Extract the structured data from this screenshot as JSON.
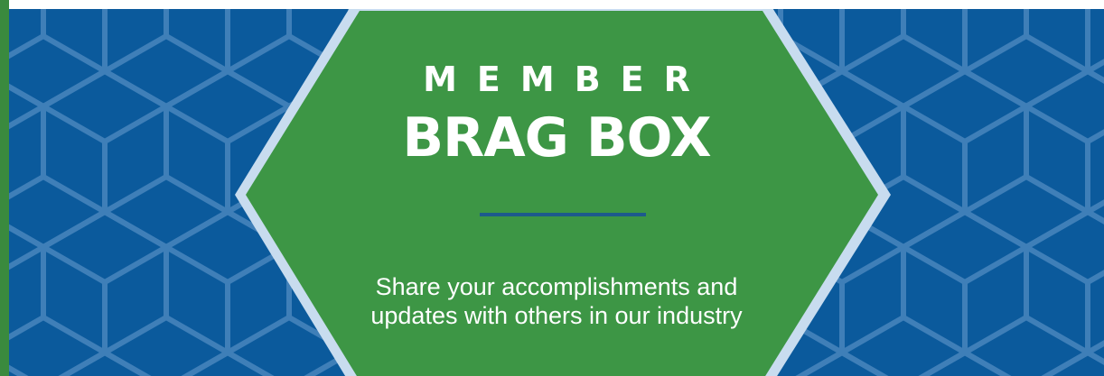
{
  "banner": {
    "kicker": "MEMBER",
    "title": "BRAG BOX",
    "tagline_line1": "Share your accomplishments and",
    "tagline_line2": "updates with others in our industry"
  },
  "colors": {
    "background_blue": "#0b5a9c",
    "hex_grid_line": "#3f7fb8",
    "hexagon_green": "#3d9645",
    "hexagon_border": "#c8dcef",
    "divider": "#1d5a8c",
    "left_strip": "#3a8a3e",
    "text": "#ffffff"
  }
}
